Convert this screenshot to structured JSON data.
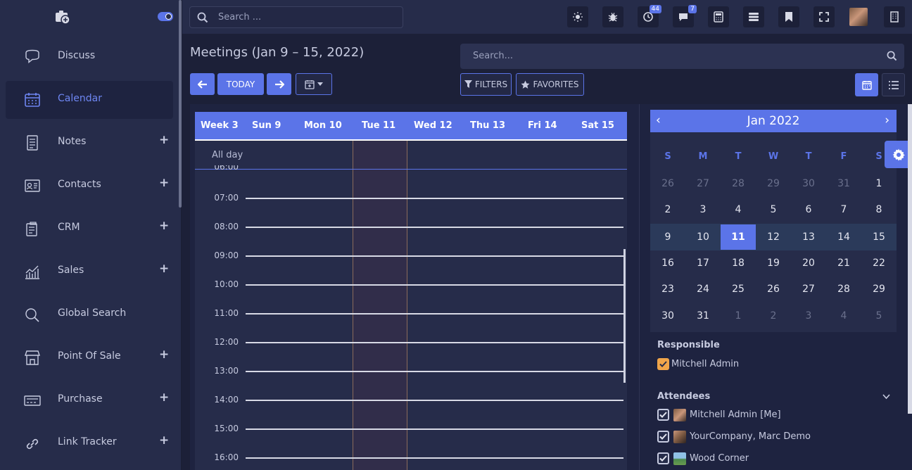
{
  "sidebar": {
    "items": [
      {
        "label": "Discuss",
        "icon": "chat-bubble-icon",
        "plus": false
      },
      {
        "label": "Calendar",
        "icon": "calendar-icon",
        "plus": false,
        "active": true
      },
      {
        "label": "Notes",
        "icon": "notes-icon",
        "plus": true
      },
      {
        "label": "Contacts",
        "icon": "contact-card-icon",
        "plus": true
      },
      {
        "label": "CRM",
        "icon": "crm-icon",
        "plus": true
      },
      {
        "label": "Sales",
        "icon": "chart-line-icon",
        "plus": true
      },
      {
        "label": "Global Search",
        "icon": "search-icon",
        "plus": false
      },
      {
        "label": "Point Of Sale",
        "icon": "store-icon",
        "plus": true
      },
      {
        "label": "Purchase",
        "icon": "card-icon",
        "plus": true
      },
      {
        "label": "Link Tracker",
        "icon": "link-icon",
        "plus": true
      }
    ],
    "plus_symbol": "+"
  },
  "topbar": {
    "search_placeholder": "Search ...",
    "activity_count": "44",
    "message_count": "7"
  },
  "control": {
    "title": "Meetings (Jan 9 – 15, 2022)",
    "today_label": "TODAY",
    "search_placeholder": "Search...",
    "filters_label": "FILTERS",
    "favorites_label": "FAVORITES"
  },
  "calendar": {
    "headers": [
      "Week 3",
      "Sun 9",
      "Mon 10",
      "Tue 11",
      "Wed 12",
      "Thu 13",
      "Fri 14",
      "Sat 15"
    ],
    "allday_label": "All day",
    "hours": [
      "06:00",
      "07:00",
      "08:00",
      "09:00",
      "10:00",
      "11:00",
      "12:00",
      "13:00",
      "14:00",
      "15:00",
      "16:00"
    ]
  },
  "mini": {
    "title": "Jan 2022",
    "prev": "‹",
    "next": "›",
    "dow": [
      "S",
      "M",
      "T",
      "W",
      "T",
      "F",
      "S"
    ],
    "weeks": [
      [
        "26",
        "27",
        "28",
        "29",
        "30",
        "31",
        "1"
      ],
      [
        "2",
        "3",
        "4",
        "5",
        "6",
        "7",
        "8"
      ],
      [
        "9",
        "10",
        "11",
        "12",
        "13",
        "14",
        "15"
      ],
      [
        "16",
        "17",
        "18",
        "19",
        "20",
        "21",
        "22"
      ],
      [
        "23",
        "24",
        "25",
        "26",
        "27",
        "28",
        "29"
      ],
      [
        "30",
        "31",
        "1",
        "2",
        "3",
        "4",
        "5"
      ]
    ],
    "selected": "11"
  },
  "filters": {
    "responsible_title": "Responsible",
    "responsible": [
      {
        "label": "Mitchell Admin"
      }
    ],
    "attendees_title": "Attendees",
    "attendees": [
      {
        "label": "Mitchell Admin [Me]"
      },
      {
        "label": "YourCompany, Marc Demo"
      },
      {
        "label": "Wood Corner"
      }
    ]
  },
  "colors": {
    "accent": "#5b74e8",
    "sidebar": "#262c4a",
    "background": "#1c2038",
    "checkbox_orange": "#f0a54a"
  }
}
